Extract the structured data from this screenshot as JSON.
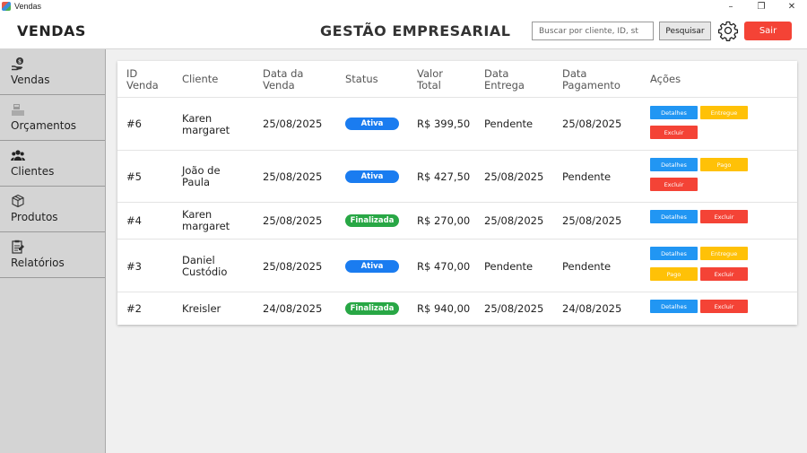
{
  "window": {
    "title": "Vendas",
    "minimize": "–",
    "restore": "❐",
    "close": "✕"
  },
  "header": {
    "left_title": "VENDAS",
    "center_title": "GESTÃO EMPRESARIAL",
    "search_placeholder": "Buscar por cliente, ID, st",
    "search_button": "Pesquisar",
    "logout_button": "Sair",
    "accent": "#f44336"
  },
  "sidebar": {
    "items": [
      {
        "label": "Vendas",
        "icon": "money-hand-icon"
      },
      {
        "label": "Orçamentos",
        "icon": "cash-register-icon"
      },
      {
        "label": "Clientes",
        "icon": "users-icon"
      },
      {
        "label": "Produtos",
        "icon": "box-icon"
      },
      {
        "label": "Relatórios",
        "icon": "report-icon"
      }
    ]
  },
  "table": {
    "headers": {
      "id": [
        "ID",
        "Venda"
      ],
      "client": "Cliente",
      "sale_date": [
        "Data da",
        "Venda"
      ],
      "status": "Status",
      "total": [
        "Valor",
        "Total"
      ],
      "delivery": [
        "Data",
        "Entrega"
      ],
      "payment": [
        "Data",
        "Pagamento"
      ],
      "actions": "Ações"
    },
    "action_labels": {
      "details": "Detalhes",
      "delivered": "Entregue",
      "paid": "Pago",
      "delete": "Excluir"
    },
    "rows": [
      {
        "id": "#6",
        "client": [
          "Karen",
          "margaret"
        ],
        "sale_date": "25/08/2025",
        "status": "Ativa",
        "total": "R$ 399,50",
        "delivery": "Pendente",
        "payment": "25/08/2025"
      },
      {
        "id": "#5",
        "client": [
          "João de",
          "Paula"
        ],
        "sale_date": "25/08/2025",
        "status": "Ativa",
        "total": "R$ 427,50",
        "delivery": "25/08/2025",
        "payment": "Pendente"
      },
      {
        "id": "#4",
        "client": [
          "Karen",
          "margaret"
        ],
        "sale_date": "25/08/2025",
        "status": "Finalizada",
        "total": "R$ 270,00",
        "delivery": "25/08/2025",
        "payment": "25/08/2025"
      },
      {
        "id": "#3",
        "client": [
          "Daniel",
          "Custódio"
        ],
        "sale_date": "25/08/2025",
        "status": "Ativa",
        "total": "R$ 470,00",
        "delivery": "Pendente",
        "payment": "Pendente"
      },
      {
        "id": "#2",
        "client": [
          "Kreisler",
          ""
        ],
        "sale_date": "24/08/2025",
        "status": "Finalizada",
        "total": "R$ 940,00",
        "delivery": "25/08/2025",
        "payment": "24/08/2025"
      }
    ],
    "colors": {
      "ativa": "#1a7cf0",
      "finalizada": "#28a745",
      "details": "#2196f3",
      "warn": "#ffc107",
      "danger": "#f44336"
    }
  }
}
